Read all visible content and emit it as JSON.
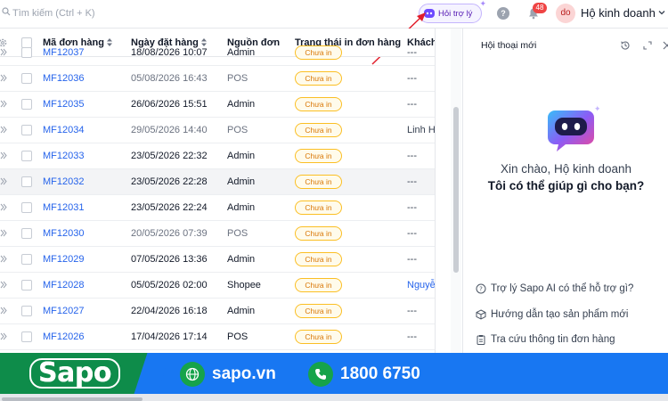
{
  "topbar": {
    "search_placeholder": "Tìm kiếm (Ctrl + K)",
    "assistant_label": "Hỏi trợ lý",
    "notification_count": "48",
    "avatar_initials": "do",
    "store_name": "Hộ kinh doanh"
  },
  "table": {
    "columns": [
      "Mã đơn hàng",
      "Ngày đặt hàng",
      "Nguồn đơn",
      "Trạng thái in đơn hàng",
      "Khách"
    ],
    "rows": [
      {
        "code": "MF12037",
        "date": "18/08/2026 10:07",
        "source": "Admin",
        "status": "Chưa in",
        "customer": "---",
        "bold": true
      },
      {
        "code": "MF12036",
        "date": "05/08/2026 16:43",
        "source": "POS",
        "status": "Chưa in",
        "customer": "---",
        "bold": false
      },
      {
        "code": "MF12035",
        "date": "26/06/2026 15:51",
        "source": "Admin",
        "status": "Chưa in",
        "customer": "---",
        "bold": true
      },
      {
        "code": "MF12034",
        "date": "29/05/2026 14:40",
        "source": "POS",
        "status": "Chưa in",
        "customer": "Linh H",
        "bold": false
      },
      {
        "code": "MF12033",
        "date": "23/05/2026 22:32",
        "source": "Admin",
        "status": "Chưa in",
        "customer": "---",
        "bold": true
      },
      {
        "code": "MF12032",
        "date": "23/05/2026 22:28",
        "source": "Admin",
        "status": "Chưa in",
        "customer": "---",
        "bold": true
      },
      {
        "code": "MF12031",
        "date": "23/05/2026 22:24",
        "source": "Admin",
        "status": "Chưa in",
        "customer": "---",
        "bold": true
      },
      {
        "code": "MF12030",
        "date": "20/05/2026 07:39",
        "source": "POS",
        "status": "Chưa in",
        "customer": "---",
        "bold": false
      },
      {
        "code": "MF12029",
        "date": "07/05/2026 13:36",
        "source": "Admin",
        "status": "Chưa in",
        "customer": "---",
        "bold": true
      },
      {
        "code": "MF12028",
        "date": "05/05/2026 02:00",
        "source": "Shopee",
        "status": "Chưa in",
        "customer": "Nguyễ",
        "bold": true
      },
      {
        "code": "MF12027",
        "date": "22/04/2026 16:18",
        "source": "Admin",
        "status": "Chưa in",
        "customer": "---",
        "bold": true
      },
      {
        "code": "MF12026",
        "date": "17/04/2026 17:14",
        "source": "POS",
        "status": "Chưa in",
        "customer": "---",
        "bold": true
      }
    ]
  },
  "panel": {
    "title": "Hội thoại mới",
    "greeting_line1": "Xin chào, Hộ kinh doanh",
    "greeting_line2": "Tôi có thể giúp gì cho bạn?",
    "suggestions": [
      "Trợ lý Sapo AI có thể hỗ trợ gì?",
      "Hướng dẫn tạo sản phẩm mới",
      "Tra cứu thông tin đơn hàng"
    ]
  },
  "banner": {
    "logo": "Sapo",
    "website": "sapo.vn",
    "phone": "1800 6750",
    "colors": {
      "green": "#0e8c4a",
      "blue": "#1877f2"
    }
  }
}
